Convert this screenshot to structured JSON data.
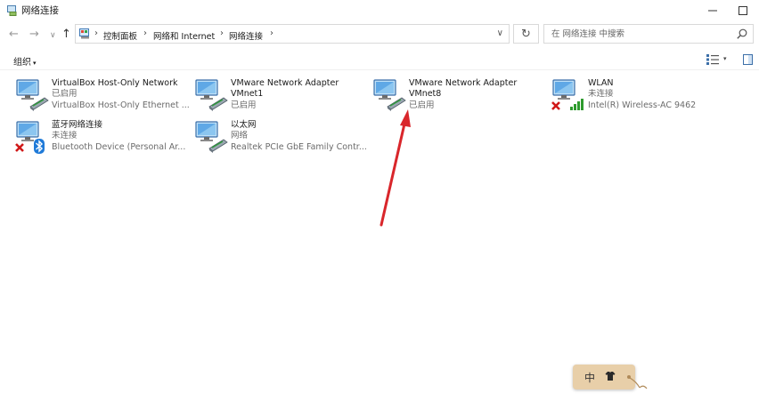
{
  "window": {
    "title": "网络连接",
    "minimize_icon": "minimize-icon",
    "maximize_icon": "maximize-icon"
  },
  "nav": {
    "back_icon": "arrow-left-icon",
    "forward_icon": "arrow-right-icon",
    "recent_icon": "chevron-down-icon",
    "up_icon": "arrow-up-icon",
    "back": "←",
    "forward": "→",
    "recent": "∨",
    "up": "↑"
  },
  "address": {
    "sep": "›",
    "breadcrumbs": [
      "控制面板",
      "网络和 Internet",
      "网络连接"
    ],
    "dropdown": "∨",
    "refresh": "↻"
  },
  "search": {
    "placeholder": "在 网络连接 中搜索"
  },
  "toolbar": {
    "organize": "组织",
    "organize_caret": "▾",
    "view_caret": "▾"
  },
  "connections": [
    {
      "name": "VirtualBox Host-Only Network",
      "status": "已启用",
      "device": "VirtualBox Host-Only Ethernet ...",
      "type": "ethernet",
      "badge": "none"
    },
    {
      "name": "VMware Network Adapter",
      "name2": "VMnet1",
      "status": "已启用",
      "type": "ethernet",
      "badge": "none"
    },
    {
      "name": "VMware Network Adapter",
      "name2": "VMnet8",
      "status": "已启用",
      "type": "ethernet",
      "badge": "none"
    },
    {
      "name": "WLAN",
      "status": "未连接",
      "device": "Intel(R) Wireless-AC 9462",
      "type": "wireless",
      "badge": "x"
    },
    {
      "name": "蓝牙网络连接",
      "status": "未连接",
      "device": "Bluetooth Device (Personal Ar...",
      "type": "bluetooth",
      "badge": "x"
    },
    {
      "name": "以太网",
      "status": "网络",
      "device": "Realtek PCIe GbE Family Contr...",
      "type": "ethernet",
      "badge": "none"
    }
  ],
  "annotation": {
    "color": "#d9262b"
  },
  "ime": {
    "label": "中",
    "icon": "shirt-icon"
  },
  "colors": {
    "accent": "#1a73c9",
    "error": "#d01818",
    "signal": "#2e9b2e",
    "annotation": "#d9262b"
  }
}
